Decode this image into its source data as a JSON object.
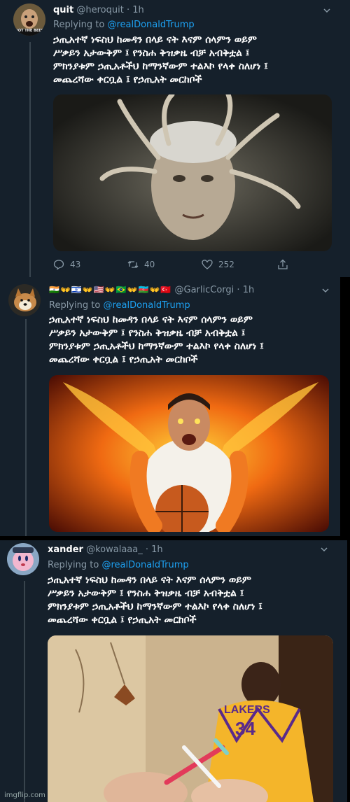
{
  "tweets": [
    {
      "name": "quit",
      "handle": "@heroquit",
      "time": "1h",
      "replying_prefix": "Replying to ",
      "mention": "@realDonaldTrump",
      "text_lines": [
        "ኃጢአተኛ ነፍስህ ከመዳን በላይ ናት እናም ሰላምን ወይም",
        "ሥቃይን አታውቅም ፤ የንስሐ ቅዝቃዜ ብቻ አብቅቷል ፤",
        "ምክንያቱም ኃጢአቶችህ ከማንኛውም ተልእኮ የላቀ ስለሆነ ፤",
        "መጨረሻው ቀርቧል ፤ የኃጢአት መርከቦች"
      ],
      "replies": "43",
      "retweets": "40",
      "likes": "252",
      "avatar_caption": "NOT THE BEES"
    },
    {
      "name": "",
      "flags": "🇮🇳👐🇮🇱👐🇺🇸👐🇧🇷👐🇦🇿👐🇹🇷",
      "handle": "@GarlicCorgi",
      "time": "1h",
      "replying_prefix": "Replying to ",
      "mention": "@realDonaldTrump",
      "text_lines": [
        "ኃጢአተኛ ነፍስህ ከመዳን በላይ ናት እናም ሰላምን ወይም",
        "ሥቃይን አታውቅም ፤ የንስሐ ቅዝቃዜ ብቻ አብቅቷል ፤",
        "ምክንያቱም ኃጢአቶችህ ከማንኛውም ተልእኮ የላቀ ስለሆነ ፤",
        "መጨረሻው ቀርቧል ፤ የኃጢአት መርከቦች"
      ]
    },
    {
      "name": "xander",
      "handle": "@kowalaaa_",
      "time": "1h",
      "replying_prefix": "Replying to ",
      "mention": "@realDonaldTrump",
      "text_lines": [
        "ኃጢአተኛ ነፍስህ ከመዳን በላይ ናት እናም ሰላምን ወይም",
        "ሥቃይን አታውቅም ፤ የንስሐ ቅዝቃዜ ብቻ አብቅቷል ፤",
        "ምክንያቱም ኃጢአቶችህ ከማንኛውም ተልእኮ የላቀ ስለሆነ ፤",
        "መጨረሻው ቀርቧል ፤ የኃጢአት መርከቦች"
      ],
      "jersey_team": "LAKERS",
      "jersey_number": "34"
    }
  ],
  "separator": " · ",
  "watermark": "imgflip.com",
  "colors": {
    "background": "#15202b",
    "secondary_text": "#8899a6",
    "link": "#1da1f2",
    "thread_line": "#38444d"
  },
  "icons": {
    "reply": "reply-icon",
    "retweet": "retweet-icon",
    "like": "heart-icon",
    "share": "share-icon",
    "menu": "chevron-down-icon"
  }
}
